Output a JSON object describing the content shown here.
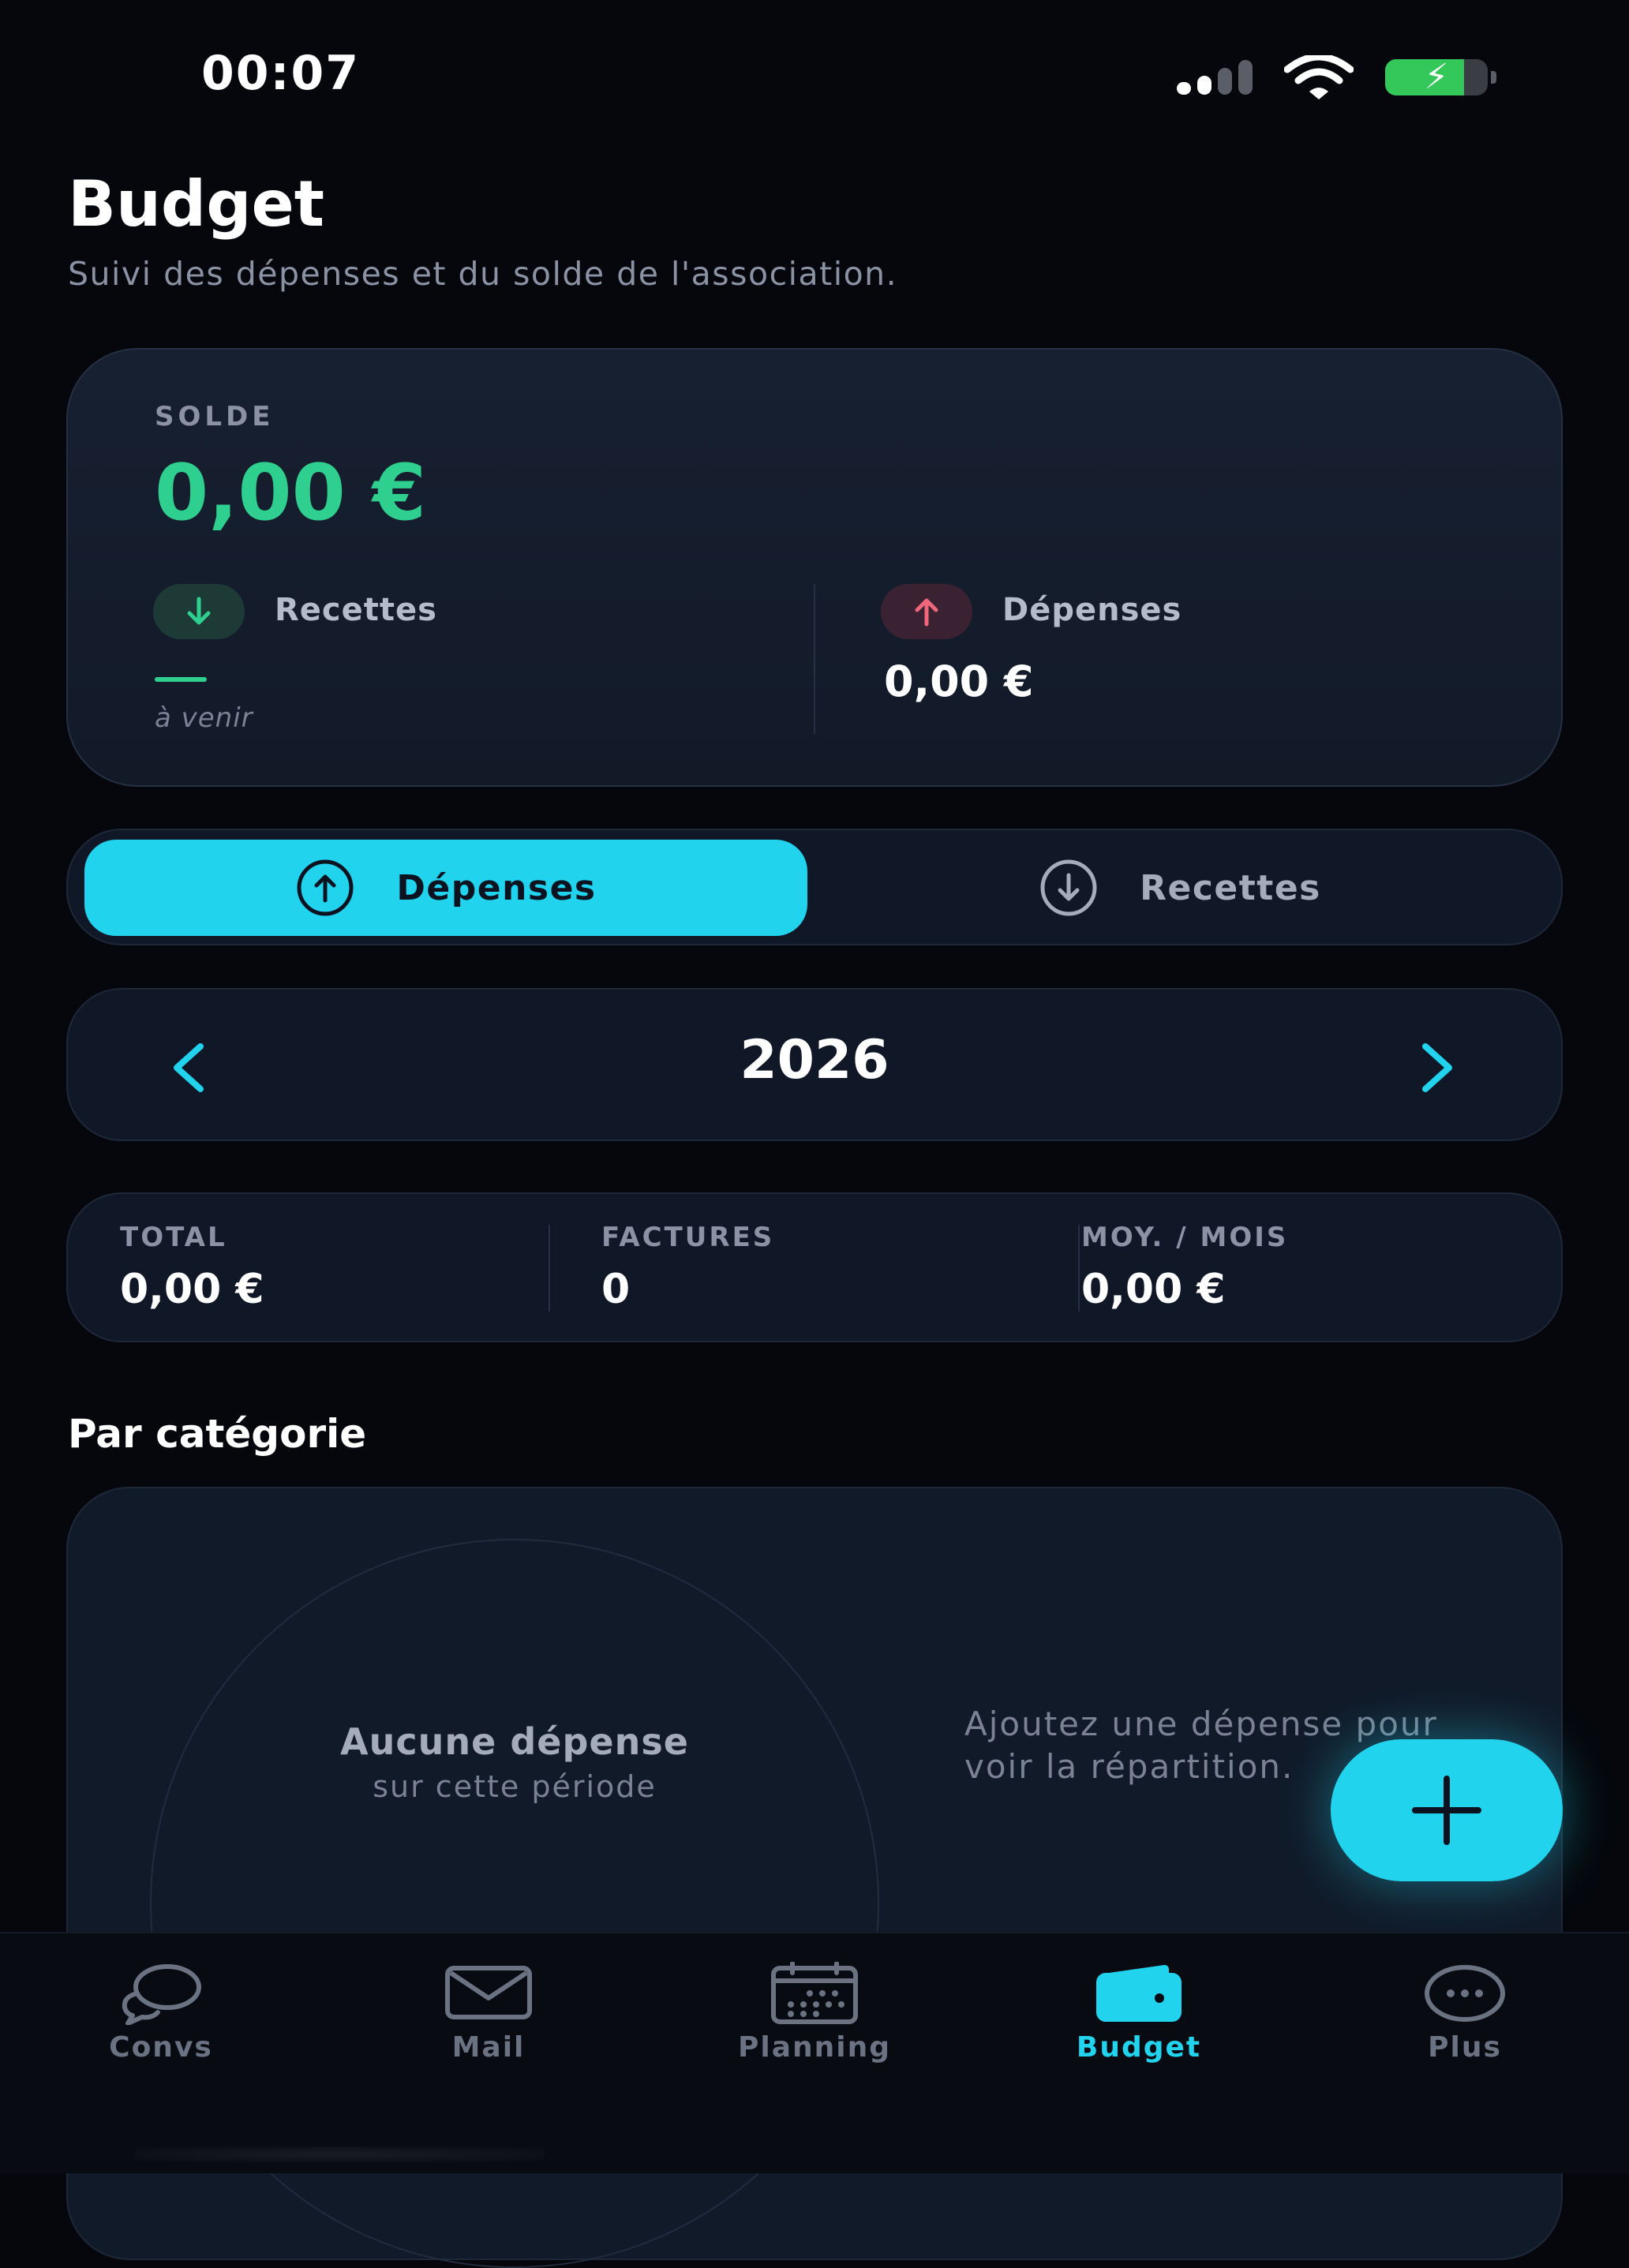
{
  "status_bar": {
    "time": "00:07"
  },
  "header": {
    "title": "Budget",
    "subtitle": "Suivi des dépenses et du solde de l'association."
  },
  "balance": {
    "label": "SOLDE",
    "amount": "0,00 €",
    "income_label": "Recettes",
    "income_value": "—",
    "income_note": "à venir",
    "expense_label": "Dépenses",
    "expense_amount": "0,00 €"
  },
  "segment": {
    "active_label": "Dépenses",
    "inactive_label": "Recettes"
  },
  "year_nav": {
    "year": "2026"
  },
  "stats": [
    {
      "label": "TOTAL",
      "value": "0,00 €"
    },
    {
      "label": "FACTURES",
      "value": "0"
    },
    {
      "label": "MOY. / MOIS",
      "value": "0,00 €"
    }
  ],
  "category": {
    "title": "Par catégorie",
    "empty_title": "Aucune dépense",
    "empty_sub": "sur cette période",
    "hint": "Ajoutez une dépense pour voir la répartition."
  },
  "tabs": [
    {
      "label": "Convs",
      "icon": "chat-bubbles-icon"
    },
    {
      "label": "Mail",
      "icon": "envelope-icon"
    },
    {
      "label": "Planning",
      "icon": "calendar-icon"
    },
    {
      "label": "Budget",
      "icon": "wallet-icon",
      "active": true
    },
    {
      "label": "Plus",
      "icon": "more-icon"
    }
  ],
  "colors": {
    "accent": "#22d3ee",
    "positive": "#2fd08f",
    "negative": "#f0667a",
    "background": "#05070c"
  }
}
